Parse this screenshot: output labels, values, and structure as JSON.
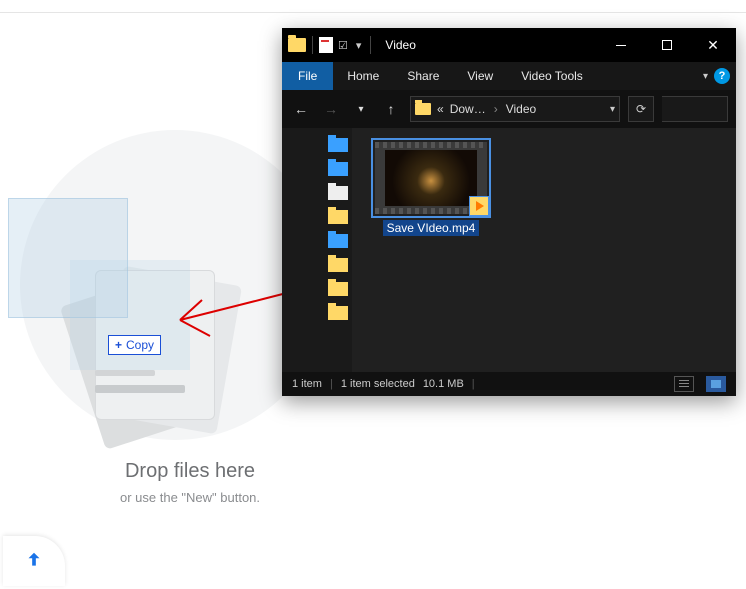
{
  "page": {
    "drop_title": "Drop files here",
    "drop_sub": "or use the \"New\" button."
  },
  "drag": {
    "copy_label": "Copy"
  },
  "explorer": {
    "window_title": "Video",
    "ribbon": {
      "file": "File",
      "home": "Home",
      "share": "Share",
      "view": "View",
      "context": "Video Tools"
    },
    "address": {
      "crumb1": "Dow…",
      "crumb2": "Video"
    },
    "file": {
      "name": "Save VIdeo.mp4"
    },
    "status": {
      "count": "1 item",
      "selection": "1 item selected",
      "size": "10.1 MB"
    }
  }
}
